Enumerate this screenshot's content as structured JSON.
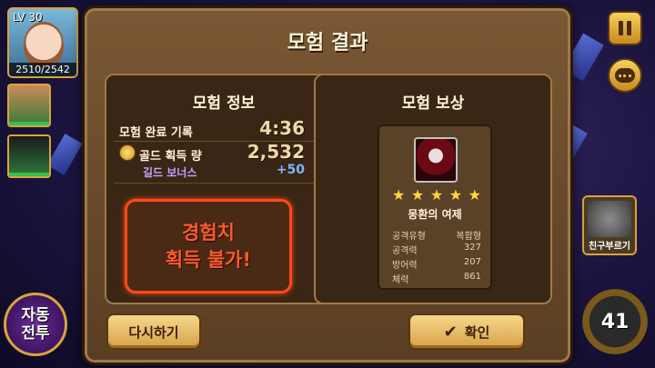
{
  "hud": {
    "hero_level": "LV 30",
    "hero_hp": "2510/2542",
    "friend_button_label": "친구부르기",
    "auto_battle_line1": "자동",
    "auto_battle_line2": "전투",
    "counter_value": "41"
  },
  "dialog": {
    "title": "모험 결과",
    "info_panel": {
      "title": "모험 정보",
      "completion_label": "모험 완료 기록",
      "completion_time": "4:36",
      "gold_label": "골드 획득 량",
      "gold_value": "2,532",
      "guild_bonus_label": "길드 보너스",
      "guild_bonus_value": "+50",
      "exp_line1": "경험치",
      "exp_line2": "획득 불가!"
    },
    "reward_panel": {
      "title": "모험 보상",
      "stars": 5,
      "item_name": "몽환의 여제",
      "stats": [
        {
          "label": "공격유형",
          "value": "복합형"
        },
        {
          "label": "공격력",
          "value": "327"
        },
        {
          "label": "방어력",
          "value": "207"
        },
        {
          "label": "체력",
          "value": "861"
        }
      ]
    },
    "buttons": {
      "retry": "다시하기",
      "confirm": "확인"
    }
  },
  "icons": {
    "pause": "pause-icon",
    "chat": "chat-icon",
    "gold": "gold-coin-icon",
    "check": "check-icon",
    "star": "star-icon"
  },
  "colors": {
    "exp_warning": "#ff5a2a",
    "guild_bonus": "#7ab8ff",
    "star": "#ffd93a"
  }
}
